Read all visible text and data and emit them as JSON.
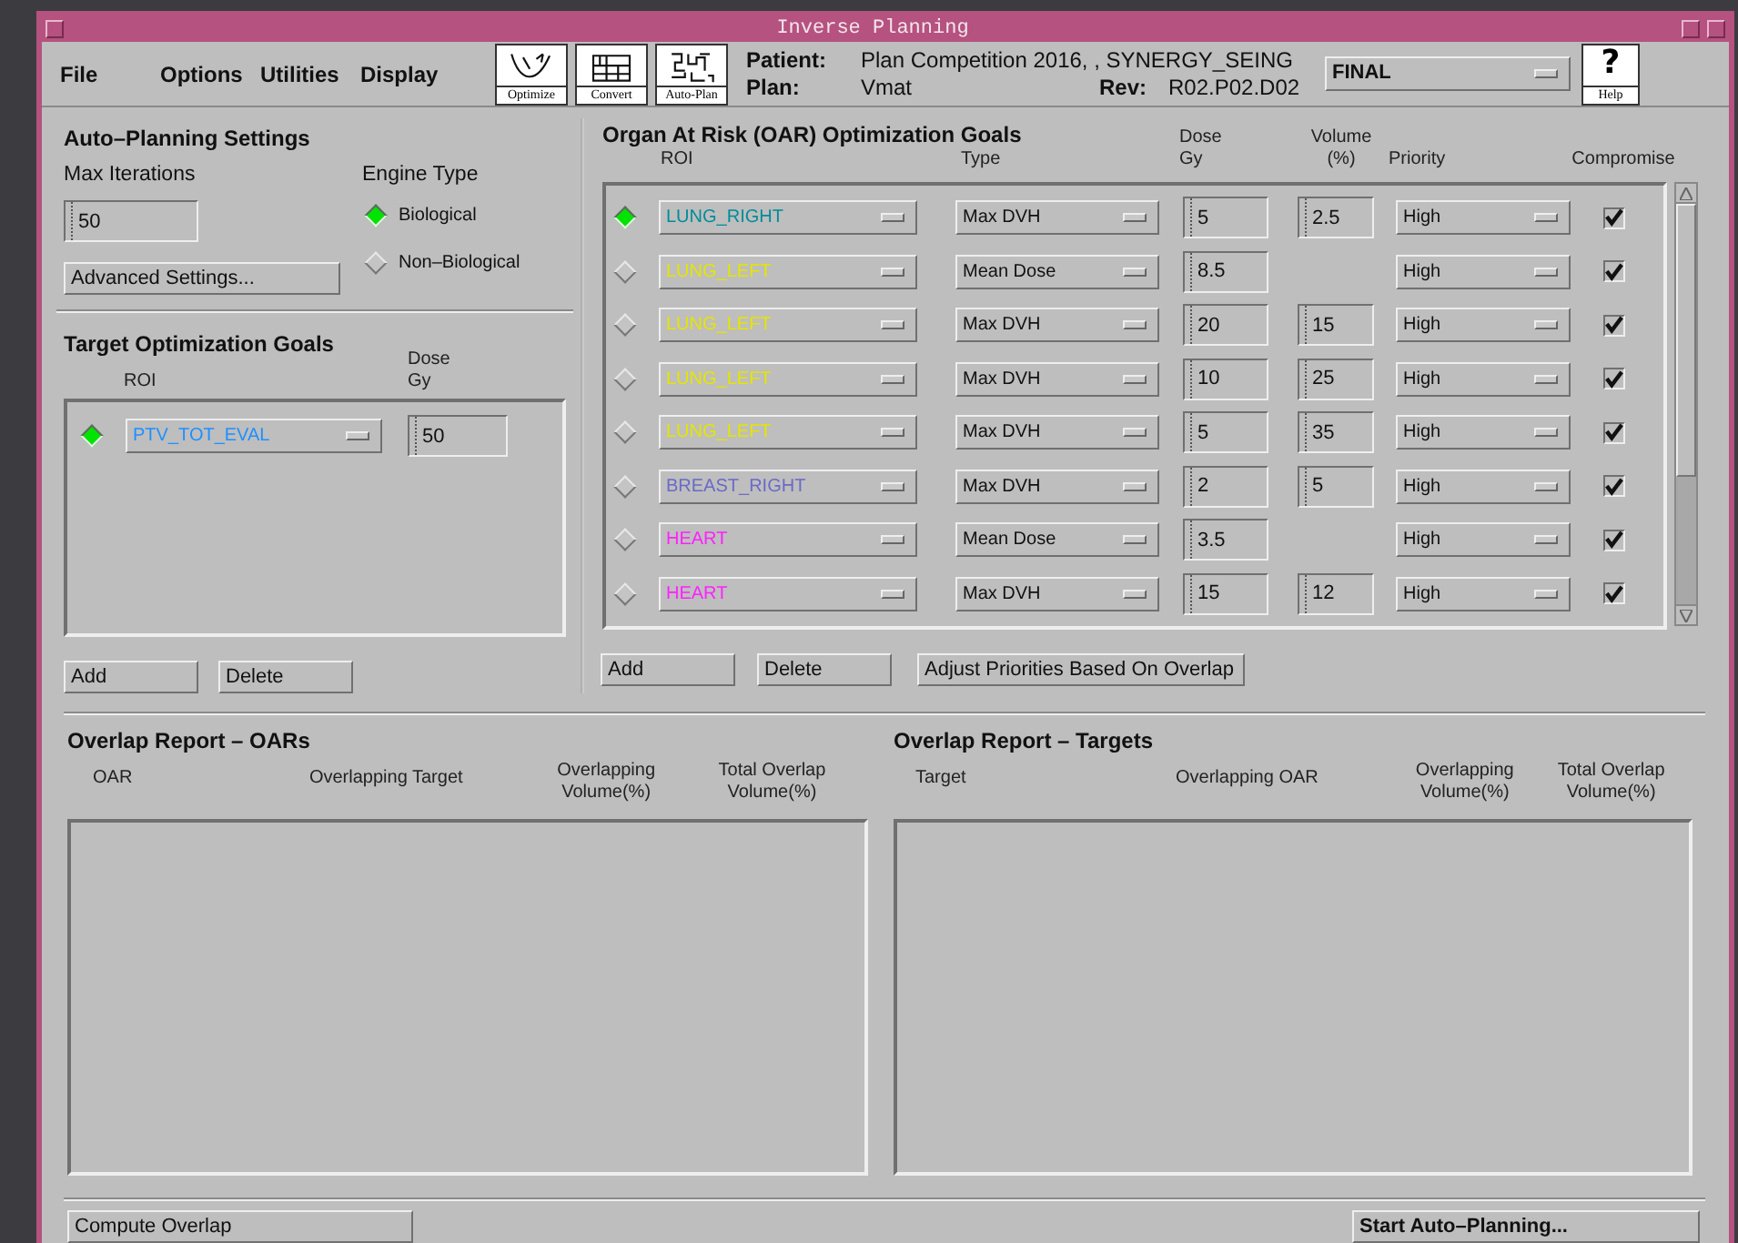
{
  "window": {
    "title": "Inverse Planning"
  },
  "menu": [
    "File",
    "Options",
    "Utilities",
    "Display"
  ],
  "toolbar": [
    {
      "kind": "optimize",
      "label": "Optimize"
    },
    {
      "kind": "convert",
      "label": "Convert"
    },
    {
      "kind": "autoplan",
      "label": "Auto-Plan"
    }
  ],
  "plan_info": {
    "patient_label": "Patient:",
    "patient": "Plan Competition 2016, , SYNERGY_SEING",
    "plan_label": "Plan:",
    "plan": "Vmat",
    "rev_label": "Rev:",
    "rev": "R02.P02.D02",
    "status": "FINAL"
  },
  "help": {
    "icon": "?",
    "label": "Help"
  },
  "auto_planning": {
    "title": "Auto–Planning Settings",
    "max_iterations_label": "Max Iterations",
    "max_iterations": "50",
    "engine_label": "Engine Type",
    "engines": [
      {
        "label": "Biological",
        "selected": true
      },
      {
        "label": "Non–Biological",
        "selected": false
      }
    ],
    "advanced_button": "Advanced Settings..."
  },
  "target_goals": {
    "title": "Target Optimization Goals",
    "columns": [
      {
        "lines": [
          "ROI"
        ]
      },
      {
        "lines": [
          "Dose",
          "Gy"
        ]
      }
    ],
    "rows": [
      {
        "selected": true,
        "roi": "PTV_TOT_EVAL",
        "color": "#1e90ff",
        "dose": "50"
      }
    ],
    "buttons": [
      "Add",
      "Delete"
    ]
  },
  "oar_goals": {
    "title": "Organ At Risk (OAR) Optimization Goals",
    "columns": [
      {
        "lines": [
          "ROI"
        ]
      },
      {
        "lines": [
          "Type"
        ]
      },
      {
        "lines": [
          "Dose",
          "Gy"
        ]
      },
      {
        "lines": [
          "Volume",
          "(%)"
        ]
      },
      {
        "lines": [
          "Priority"
        ]
      },
      {
        "lines": [
          "Compromise"
        ]
      }
    ],
    "rows": [
      {
        "selected": true,
        "roi": "LUNG_RIGHT",
        "color": "#008c99",
        "type": "Max DVH",
        "dose": "5",
        "volume": "2.5",
        "priority": "High",
        "compromise": true
      },
      {
        "selected": false,
        "roi": "LUNG_LEFT",
        "color": "#e5e500",
        "type": "Mean Dose",
        "dose": "8.5",
        "priority": "High",
        "compromise": true
      },
      {
        "selected": false,
        "roi": "LUNG_LEFT",
        "color": "#e5e500",
        "type": "Max DVH",
        "dose": "20",
        "volume": "15",
        "priority": "High",
        "compromise": true
      },
      {
        "selected": false,
        "roi": "LUNG_LEFT",
        "color": "#e5e500",
        "type": "Max DVH",
        "dose": "10",
        "volume": "25",
        "priority": "High",
        "compromise": true
      },
      {
        "selected": false,
        "roi": "LUNG_LEFT",
        "color": "#e5e500",
        "type": "Max DVH",
        "dose": "5",
        "volume": "35",
        "priority": "High",
        "compromise": true
      },
      {
        "selected": false,
        "roi": "BREAST_RIGHT",
        "color": "#6a6ac8",
        "type": "Max DVH",
        "dose": "2",
        "volume": "5",
        "priority": "High",
        "compromise": true
      },
      {
        "selected": false,
        "roi": "HEART",
        "color": "#ff20ff",
        "type": "Mean Dose",
        "dose": "3.5",
        "priority": "High",
        "compromise": true
      },
      {
        "selected": false,
        "roi": "HEART",
        "color": "#ff20ff",
        "type": "Max DVH",
        "dose": "15",
        "volume": "12",
        "priority": "High",
        "compromise": true
      }
    ],
    "buttons": [
      "Add",
      "Delete",
      "Adjust Priorities Based On Overlap"
    ]
  },
  "overlap_oars": {
    "title": "Overlap Report – OARs",
    "columns": [
      {
        "lines": [
          "OAR"
        ]
      },
      {
        "lines": [
          "Overlapping Target"
        ]
      },
      {
        "lines": [
          "Overlapping",
          "Volume(%)"
        ]
      },
      {
        "lines": [
          "Total Overlap",
          "Volume(%)"
        ]
      }
    ]
  },
  "overlap_targets": {
    "title": "Overlap Report – Targets",
    "columns": [
      {
        "lines": [
          "Target"
        ]
      },
      {
        "lines": [
          "Overlapping OAR"
        ]
      },
      {
        "lines": [
          "Overlapping",
          "Volume(%)"
        ]
      },
      {
        "lines": [
          "Total Overlap",
          "Volume(%)"
        ]
      }
    ]
  },
  "footer": {
    "compute_button": "Compute Overlap",
    "start_button": "Start Auto–Planning..."
  }
}
